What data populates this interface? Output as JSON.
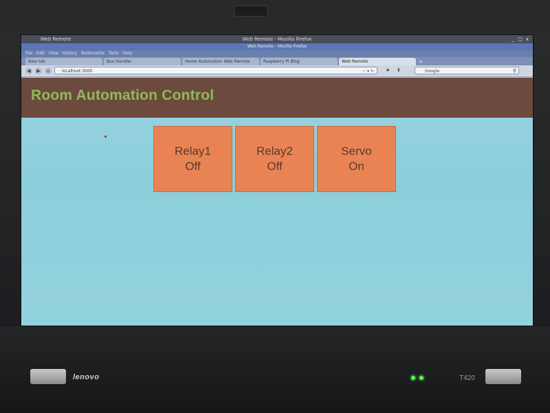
{
  "os": {
    "left_title": "Web Remote",
    "window_controls": [
      "_",
      "□",
      "x"
    ]
  },
  "browser": {
    "window_title": "Web Remote - Mozilla Firefox",
    "menu_items": [
      "File",
      "Edit",
      "View",
      "History",
      "Bookmarks",
      "Tools",
      "Help"
    ],
    "tabs": [
      {
        "label": "New tab",
        "active": false
      },
      {
        "label": "Bus Handler",
        "active": false
      },
      {
        "label": "Home Automation Web Remote",
        "active": false
      },
      {
        "label": "Raspberry Pi Blog",
        "active": false
      },
      {
        "label": "Web Remote",
        "active": true
      }
    ],
    "url": "localhost:3000",
    "search_engine": "Google",
    "search_placeholder": "Google"
  },
  "page": {
    "title": "Room Automation Control",
    "controls": [
      {
        "name": "Relay1",
        "state": "Off"
      },
      {
        "name": "Relay2",
        "state": "Off"
      },
      {
        "name": "Servo",
        "state": "On"
      }
    ]
  },
  "laptop": {
    "brand": "lenovo",
    "model": "T420"
  },
  "colors": {
    "header_bg": "#6d4a3e",
    "title_color": "#8fb95a",
    "button_bg": "#e98354",
    "page_bg": "#8fcfdc"
  }
}
